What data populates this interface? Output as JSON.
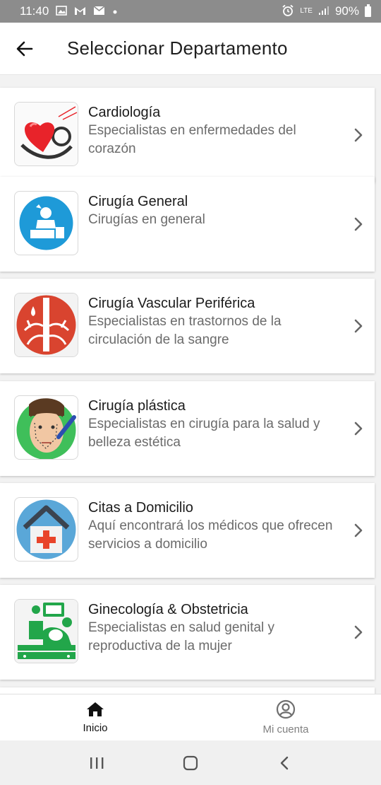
{
  "status_bar": {
    "time": "11:40",
    "left_icons": [
      "image-icon",
      "gmail-icon",
      "mail-icon",
      "dot-icon"
    ],
    "network": "LTE",
    "battery": "90%"
  },
  "header": {
    "title": "Seleccionar Departamento"
  },
  "departments": [
    {
      "title": "Cardiología",
      "subtitle": "Especialistas en enfermedades del corazón",
      "icon": "heart-stethoscope-icon"
    },
    {
      "title": "Cirugía General",
      "subtitle": "Cirugías en general",
      "icon": "surgeon-icon"
    },
    {
      "title": "Cirugía Vascular Periférica",
      "subtitle": "Especialistas en trastornos de la circulación de la sangre",
      "icon": "blood-vessel-icon"
    },
    {
      "title": "Cirugía plástica",
      "subtitle": "Especialistas en cirugía para la salud y belleza estética",
      "icon": "face-surgery-icon"
    },
    {
      "title": "Citas a Domicilio",
      "subtitle": "Aquí encontrará los médicos que ofrecen servicios a domicilio",
      "icon": "home-medical-icon"
    },
    {
      "title": "Ginecología & Obstetricia",
      "subtitle": "Especialistas en salud genital y reproductiva de la mujer",
      "icon": "ultrasound-icon"
    }
  ],
  "bottom_nav": {
    "home_label": "Inicio",
    "account_label": "Mi cuenta"
  },
  "colors": {
    "status_bar": "#8c8c8c",
    "surface": "#ffffff",
    "title_text": "#1f1f1f",
    "subtitle_text": "#6b6b6b",
    "inactive_nav": "#808080"
  }
}
